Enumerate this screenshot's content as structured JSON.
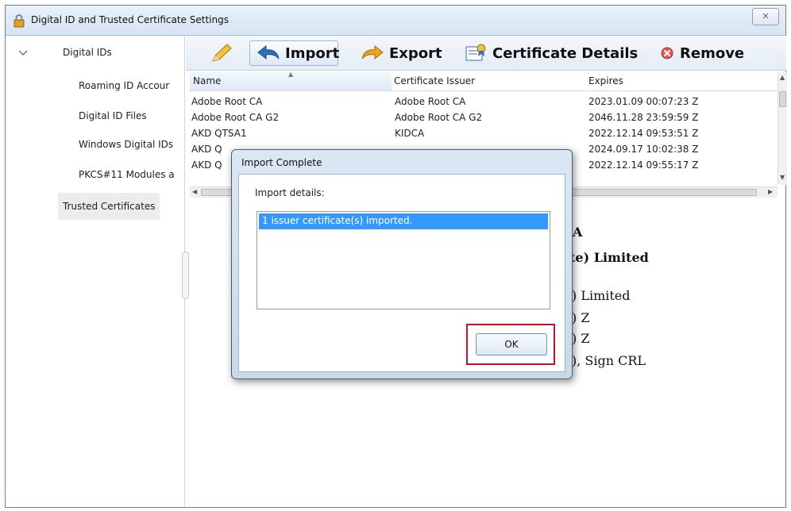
{
  "window": {
    "title": "Digital ID and Trusted Certificate Settings",
    "close_label": "✕"
  },
  "sidebar": {
    "items": [
      {
        "label": "Digital IDs"
      },
      {
        "label": "Roaming ID Accour"
      },
      {
        "label": "Digital ID Files"
      },
      {
        "label": "Windows Digital IDs"
      },
      {
        "label": "PKCS#11 Modules a"
      },
      {
        "label": "Trusted Certificates"
      }
    ]
  },
  "toolbar": {
    "import_label": "Import",
    "export_label": "Export",
    "details_label": "Certificate Details",
    "remove_label": "Remove"
  },
  "table": {
    "columns": [
      "Name",
      "Certificate Issuer",
      "Expires"
    ],
    "rows": [
      {
        "name": "Adobe Root CA",
        "issuer": "Adobe Root CA",
        "expires": "2023.01.09 00:07:23 Z"
      },
      {
        "name": "Adobe Root CA G2",
        "issuer": "Adobe Root CA G2",
        "expires": "2046.11.28 23:59:59 Z"
      },
      {
        "name": "AKD QTSA1",
        "issuer": "KIDCA",
        "expires": "2022.12.14 09:53:51 Z"
      },
      {
        "name": "AKD Q",
        "issuer": "",
        "expires": "2024.09.17 10:02:38 Z"
      },
      {
        "name": "AKD Q",
        "issuer": "",
        "expires": "2022.12.14 09:55:17 Z"
      }
    ]
  },
  "details": {
    "line1": "A",
    "line2": "te) Limited",
    "line3": ") Limited",
    "line4": ") Z",
    "line5": ") Z",
    "line6": "), Sign CRL"
  },
  "dialog": {
    "title": "Import Complete",
    "details_label": "Import details:",
    "message": "1 issuer certificate(s) imported.",
    "ok_label": "OK"
  },
  "colors": {
    "selection": "#3399ff",
    "highlight_box": "#c8102e",
    "remove_icon": "#e05a5a"
  }
}
